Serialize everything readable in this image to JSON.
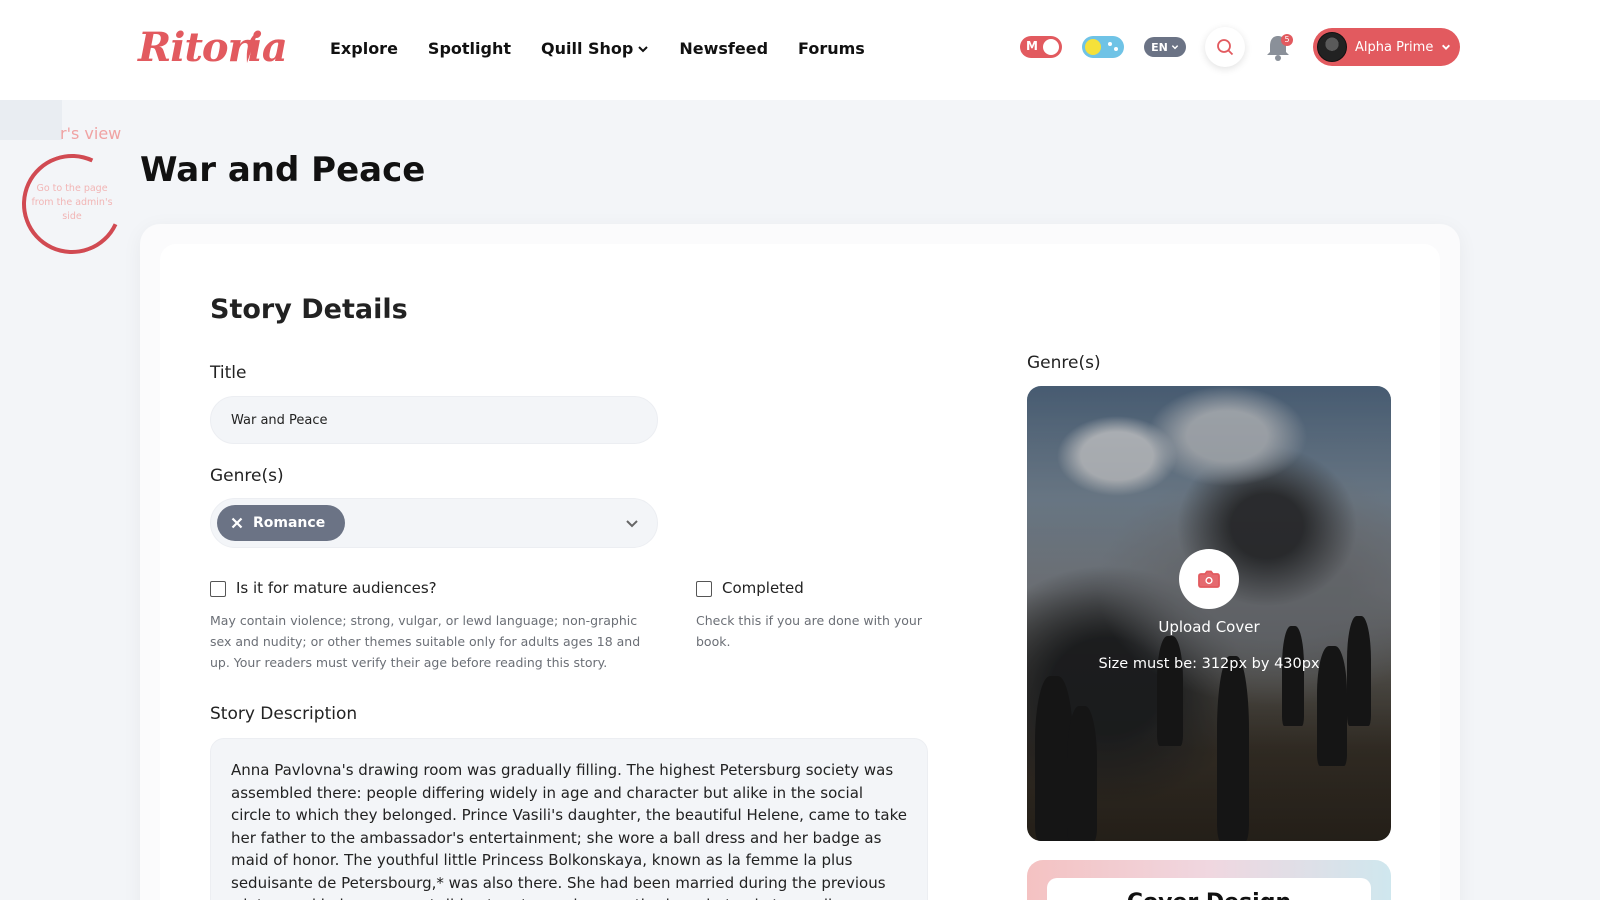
{
  "header": {
    "logo": "Ritoria",
    "nav": [
      "Explore",
      "Spotlight",
      "Quill Shop",
      "Newsfeed",
      "Forums"
    ],
    "mature_toggle_label": "M",
    "language": "EN",
    "notification_count": "5",
    "user_name": "Alpha Prime"
  },
  "admin_view": {
    "label": "r's view",
    "hint": "Go to the page from the admin's side"
  },
  "page": {
    "title": "War and Peace"
  },
  "story_details": {
    "heading": "Story Details",
    "title_label": "Title",
    "title_value": "War and Peace",
    "genre_label": "Genre(s)",
    "genre_chip": "Romance",
    "mature": {
      "label": "Is it for mature audiences?",
      "help": "May contain violence; strong, vulgar, or lewd language; non-graphic sex and nudity; or other themes suitable only for adults ages 18 and up. Your readers must verify their age before reading this story."
    },
    "completed": {
      "label": "Completed",
      "help": "Check this if you are done with your book."
    },
    "description_label": "Story Description",
    "description": "Anna Pavlovna's drawing room was gradually filling. The highest Petersburg society was assembled there: people differing widely in age and character but alike in the social circle to which they belonged. Prince Vasili's daughter, the beautiful Helene, came to take her father to the ambassador's entertainment; she wore a ball dress and her badge as maid of honor. The youthful little Princess Bolkonskaya, known as la femme la plus seduisante de Petersbourg,* was also there. She had been married during the previous winter, and being pregnant did not go to any large gatherings, but only to small receptions. Prince Vasili's son, Hippolyte, had come with Mortemart, whom he introduced."
  },
  "cover": {
    "label": "Genre(s)",
    "upload": "Upload Cover",
    "size": "Size must be: 312px by 430px",
    "design_heading": "Cover Design"
  },
  "colors": {
    "accent": "#e25a5f",
    "chip": "#6b7385"
  }
}
